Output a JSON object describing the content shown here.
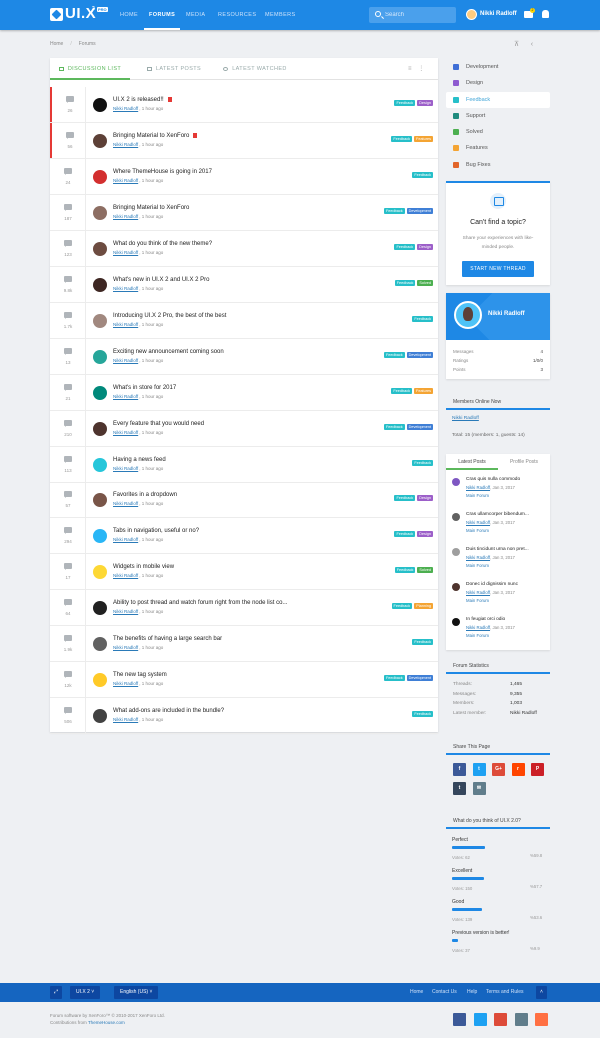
{
  "nav": {
    "logo": "UI.X",
    "logo_sup": "2",
    "logo_pro": "PRO",
    "links": [
      "HOME",
      "FORUMS",
      "MEDIA",
      "RESOURCES",
      "MEMBERS"
    ],
    "search_placeholder": "Search",
    "username": "Nikki Radloff",
    "inbox_badge": "2"
  },
  "breadcrumb": [
    "Home",
    "Forums"
  ],
  "tabs": [
    "DISCUSSION LIST",
    "LATEST POSTS",
    "LATEST WATCHED"
  ],
  "threads": [
    {
      "replies": "26",
      "title": "UI.X 2 is released!!",
      "author": "Nikki Radloff",
      "time": "1 hour ago",
      "tags": [
        "Feedback",
        "Design"
      ],
      "sticky": true,
      "av": "#111111"
    },
    {
      "replies": "56",
      "title": "Bringing Material to XenForo",
      "author": "Nikki Radloff",
      "time": "1 hour ago",
      "tags": [
        "Feedback",
        "Features"
      ],
      "sticky": true,
      "av": "#5d4037"
    },
    {
      "replies": "24",
      "title": "Where ThemeHouse is going in 2017",
      "author": "Nikki Radloff",
      "time": "1 hour ago",
      "tags": [
        "Feedback"
      ],
      "av": "#d32f2f"
    },
    {
      "replies": "187",
      "title": "Bringing Material to XenForo",
      "author": "Nikki Radloff",
      "time": "1 hour ago",
      "tags": [
        "Feedback",
        "Development"
      ],
      "av": "#8d6e63"
    },
    {
      "replies": "123",
      "title": "What do you think of the new theme?",
      "author": "Nikki Radloff",
      "time": "1 hour ago",
      "tags": [
        "Feedback",
        "Design"
      ],
      "av": "#6d4c41"
    },
    {
      "replies": "9.8k",
      "title": "What's new in UI.X 2 and UI.X 2 Pro",
      "author": "Nikki Radloff",
      "time": "1 hour ago",
      "tags": [
        "Feedback",
        "Solved"
      ],
      "av": "#3e2723"
    },
    {
      "replies": "1.7k",
      "title": "Introducing UI.X 2 Pro, the best of the best",
      "author": "Nikki Radloff",
      "time": "1 hour ago",
      "tags": [
        "Feedback"
      ],
      "av": "#a1887f"
    },
    {
      "replies": "13",
      "title": "Exciting new announcement coming soon",
      "author": "Nikki Radloff",
      "time": "1 hour ago",
      "tags": [
        "Feedback",
        "Development"
      ],
      "av": "#26a69a"
    },
    {
      "replies": "21",
      "title": "What's in store for 2017",
      "author": "Nikki Radloff",
      "time": "1 hour ago",
      "tags": [
        "Feedback",
        "Features"
      ],
      "av": "#00897b"
    },
    {
      "replies": "210",
      "title": "Every feature that you would need",
      "author": "Nikki Radloff",
      "time": "1 hour ago",
      "tags": [
        "Feedback",
        "Development"
      ],
      "av": "#4e342e"
    },
    {
      "replies": "113",
      "title": "Having a news feed",
      "author": "Nikki Radloff",
      "time": "1 hour ago",
      "tags": [
        "Feedback"
      ],
      "av": "#26c6da"
    },
    {
      "replies": "57",
      "title": "Favorites in a dropdown",
      "author": "Nikki Radloff",
      "time": "1 hour ago",
      "tags": [
        "Feedback",
        "Design"
      ],
      "av": "#795548"
    },
    {
      "replies": "294",
      "title": "Tabs in navigation, useful or no?",
      "author": "Nikki Radloff",
      "time": "1 hour ago",
      "tags": [
        "Feedback",
        "Design"
      ],
      "av": "#29b6f6"
    },
    {
      "replies": "17",
      "title": "Widgets in mobile view",
      "author": "Nikki Radloff",
      "time": "1 hour ago",
      "tags": [
        "Feedback",
        "Solved"
      ],
      "av": "#fdd835"
    },
    {
      "replies": "64",
      "title": "Ability to post thread and watch forum right from the node list co...",
      "author": "Nikki Radloff",
      "time": "1 hour ago",
      "tags": [
        "Feedback",
        "Planning"
      ],
      "av": "#212121"
    },
    {
      "replies": "1.9k",
      "title": "The benefits of having a large search bar",
      "author": "Nikki Radloff",
      "time": "1 hour ago",
      "tags": [
        "Feedback"
      ],
      "av": "#616161"
    },
    {
      "replies": "12k",
      "title": "The new tag system",
      "author": "Nikki Radloff",
      "time": "1 hour ago",
      "tags": [
        "Feedback",
        "Development"
      ],
      "av": "#ffca28"
    },
    {
      "replies": "506",
      "title": "What add-ons are included in the bundle?",
      "author": "Nikki Radloff",
      "time": "1 hour ago",
      "tags": [
        "Feedback"
      ],
      "av": "#424242"
    }
  ],
  "tag_colors": {
    "Feedback": "#26bfc9",
    "Design": "#9c5fc9",
    "Features": "#f4a433",
    "Development": "#3f7fd6",
    "Solved": "#4caf50",
    "Planning": "#f4a433"
  },
  "forums": [
    {
      "name": "Development",
      "color": "#3f6fd6"
    },
    {
      "name": "Design",
      "color": "#8e5bd0"
    },
    {
      "name": "Feedback",
      "color": "#26bfc9",
      "active": true
    },
    {
      "name": "Support",
      "color": "#1f8b7e"
    },
    {
      "name": "Solved",
      "color": "#4caf50"
    },
    {
      "name": "Features",
      "color": "#f4a433"
    },
    {
      "name": "Bug Fixes",
      "color": "#e2652a"
    }
  ],
  "cant_find": {
    "title": "Can't find a topic?",
    "text": "Share your experiences with like-minded people.",
    "button": "START NEW THREAD"
  },
  "profile": {
    "name": "Nikki Radloff",
    "stats": [
      {
        "label": "Messages",
        "value": "4"
      },
      {
        "label": "Ratings",
        "value": "1/0/0"
      },
      {
        "label": "Points",
        "value": "3"
      }
    ]
  },
  "online": {
    "title": "Members Online Now",
    "user": "Nikki Radloff",
    "total": "Total: 15 (members: 1, guests: 14)"
  },
  "latest": {
    "tabs": [
      "Latest Posts",
      "Profile Posts"
    ],
    "posts": [
      {
        "title": "Cras quis nulla commodo",
        "author": "Nikki Radloff",
        "date": "Jan 3, 2017",
        "forum": "Main Forum",
        "color": "#7e57c2"
      },
      {
        "title": "Cras ullamcorper bibendum...",
        "author": "Nikki Radloff",
        "date": "Jan 3, 2017",
        "forum": "Main Forum",
        "color": "#616161"
      },
      {
        "title": "Duis tincidunt urna non pret...",
        "author": "Nikki Radloff",
        "date": "Jan 3, 2017",
        "forum": "Main Forum",
        "color": "#9e9e9e"
      },
      {
        "title": "Donec id dignissim nunc",
        "author": "Nikki Radloff",
        "date": "Jan 3, 2017",
        "forum": "Main Forum",
        "color": "#4e342e"
      },
      {
        "title": "In feugiat orci odio",
        "author": "Nikki Radloff",
        "date": "Jan 3, 2017",
        "forum": "Main Forum",
        "color": "#111111"
      }
    ]
  },
  "forum_stats": {
    "title": "Forum Statistics",
    "rows": [
      {
        "label": "Threads:",
        "value": "1,465"
      },
      {
        "label": "Messages:",
        "value": "9,355"
      },
      {
        "label": "Members:",
        "value": "1,003"
      },
      {
        "label": "Latest member:",
        "value": "Nikki Radloff"
      }
    ]
  },
  "share": {
    "title": "Share This Page",
    "buttons": [
      {
        "icon": "f",
        "color": "#3b5998"
      },
      {
        "icon": "t",
        "color": "#1da1f2"
      },
      {
        "icon": "G+",
        "color": "#dd4b39"
      },
      {
        "icon": "r",
        "color": "#ff4500"
      },
      {
        "icon": "P",
        "color": "#cb2027"
      },
      {
        "icon": "t",
        "color": "#35465c"
      },
      {
        "icon": "✉",
        "color": "#607d8b"
      }
    ]
  },
  "poll": {
    "title": "What do you think of UI.X 2.0?",
    "options": [
      {
        "name": "Perfect",
        "votes": "Votes: 62",
        "pct": "%59.8",
        "fill": 0.598
      },
      {
        "name": "Excellent",
        "votes": "Votes: 150",
        "pct": "%57.7",
        "fill": 0.577
      },
      {
        "name": "Good",
        "votes": "Votes: 139",
        "pct": "%53.6",
        "fill": 0.536
      },
      {
        "name": "Previous version is better!",
        "votes": "Votes: 37",
        "pct": "%9.9",
        "fill": 0.099
      }
    ]
  },
  "footer": {
    "style": "UI.X 2",
    "language": "English (US)",
    "links": [
      "Home",
      "Contact Us",
      "Help",
      "Terms and Rules"
    ],
    "copy1": "Forum software by XenForo™ © 2010-2017 XenForo Ltd.",
    "copy2": "Contributions from",
    "copy_link": "ThemeHouse.com",
    "social": [
      "#3b5998",
      "#1da1f2",
      "#dd4b39",
      "#607d8b",
      "#ff7043"
    ]
  }
}
